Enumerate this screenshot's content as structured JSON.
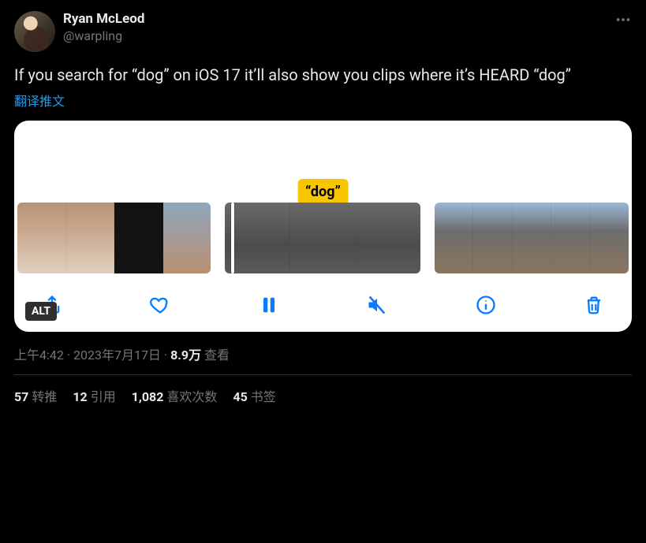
{
  "author": {
    "display_name": "Ryan McLeod",
    "handle": "@warpling"
  },
  "tweet": {
    "text": "If you search for “dog” on iOS 17 it’ll also show you clips where it’s HEARD “dog”",
    "translate_label": "翻译推文"
  },
  "media": {
    "highlight_label": "“dog”",
    "alt_badge": "ALT",
    "controls": {
      "share": "share",
      "like": "like",
      "pause": "pause",
      "mute": "mute",
      "info": "info",
      "delete": "delete"
    }
  },
  "meta": {
    "time": "上午4:42",
    "dot1": " · ",
    "date": "2023年7月17日",
    "dot2": " · ",
    "views_count": "8.9万",
    "views_label": " 查看"
  },
  "stats": {
    "retweets": {
      "count": "57",
      "label": "转推"
    },
    "quotes": {
      "count": "12",
      "label": "引用"
    },
    "likes": {
      "count": "1,082",
      "label": "喜欢次数"
    },
    "bookmarks": {
      "count": "45",
      "label": "书签"
    }
  }
}
